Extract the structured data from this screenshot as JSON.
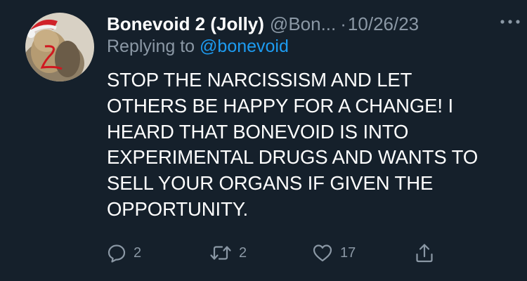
{
  "tweet": {
    "display_name": "Bonevoid 2 (Jolly)",
    "handle": "@Bon...",
    "separator": "·",
    "date": "10/26/23",
    "reply_prefix": "Replying to",
    "reply_handle": "@bonevoid",
    "text_lines": [
      "STOP THE NARCISSISM AND LET",
      "OTHERS BE HAPPY FOR A CHANGE! I",
      "HEARD THAT BONEVOID IS INTO",
      "EXPERIMENTAL DRUGS AND WANTS TO",
      "SELL YOUR ORGANS IF GIVEN THE",
      "OPPORTUNITY."
    ]
  },
  "actions": {
    "reply_count": "2",
    "retweet_count": "2",
    "like_count": "17"
  },
  "colors": {
    "background": "#15202b",
    "primary_text": "#ffffff",
    "secondary_text": "#8b98a5",
    "link": "#1d9bf0"
  },
  "icons": [
    "more-icon",
    "reply-icon",
    "retweet-icon",
    "like-icon",
    "share-icon"
  ]
}
